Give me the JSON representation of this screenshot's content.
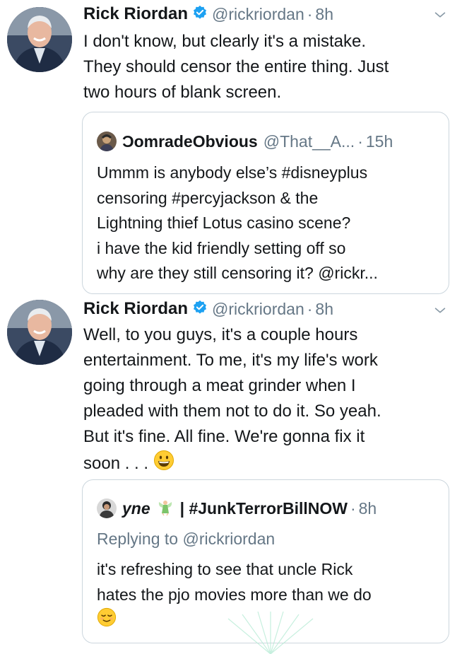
{
  "tweet1": {
    "name": "Rick Riordan",
    "handle": "@rickriordan",
    "separator": "·",
    "time": "8h",
    "lines": [
      "I don't know, but clearly it's a mistake.",
      "They should censor the entire thing. Just",
      "two hours of blank screen."
    ],
    "quote": {
      "name": "ƆomradeObvious",
      "handle": "@That__A...",
      "separator": "·",
      "time": "15h",
      "lines": [
        "Ummm is anybody else’s #disneyplus",
        "censoring  #percyjackson & the",
        "Lightning thief Lotus casino scene?",
        "i have the kid friendly setting off so",
        "why are they still censoring it? @rickr..."
      ]
    }
  },
  "tweet2": {
    "name": "Rick Riordan",
    "handle": "@rickriordan",
    "separator": "·",
    "time": "8h",
    "lines": [
      "Well, to you guys, it's a couple hours",
      "entertainment. To me, it's my life's work",
      "going through a meat grinder when I",
      "pleaded with them not to do it. So yeah.",
      "But it's fine. All fine. We're gonna fix it",
      "soon . . ."
    ],
    "emoji": "grinning-face",
    "quote": {
      "name_part1": "yne",
      "name_part2": "| #JunkTerrorBillNOW",
      "separator": "·",
      "time": "8h",
      "replying_prefix": "Replying to",
      "replying_handle": "@rickriordan",
      "lines": [
        "it's refreshing to see that uncle Rick",
        "hates the pjo movies more than we do"
      ],
      "emoji": "relieved-face"
    }
  },
  "colors": {
    "text": "#14171a",
    "secondary": "#657786",
    "verified": "#1da1f2",
    "border": "#ccd6dd"
  }
}
